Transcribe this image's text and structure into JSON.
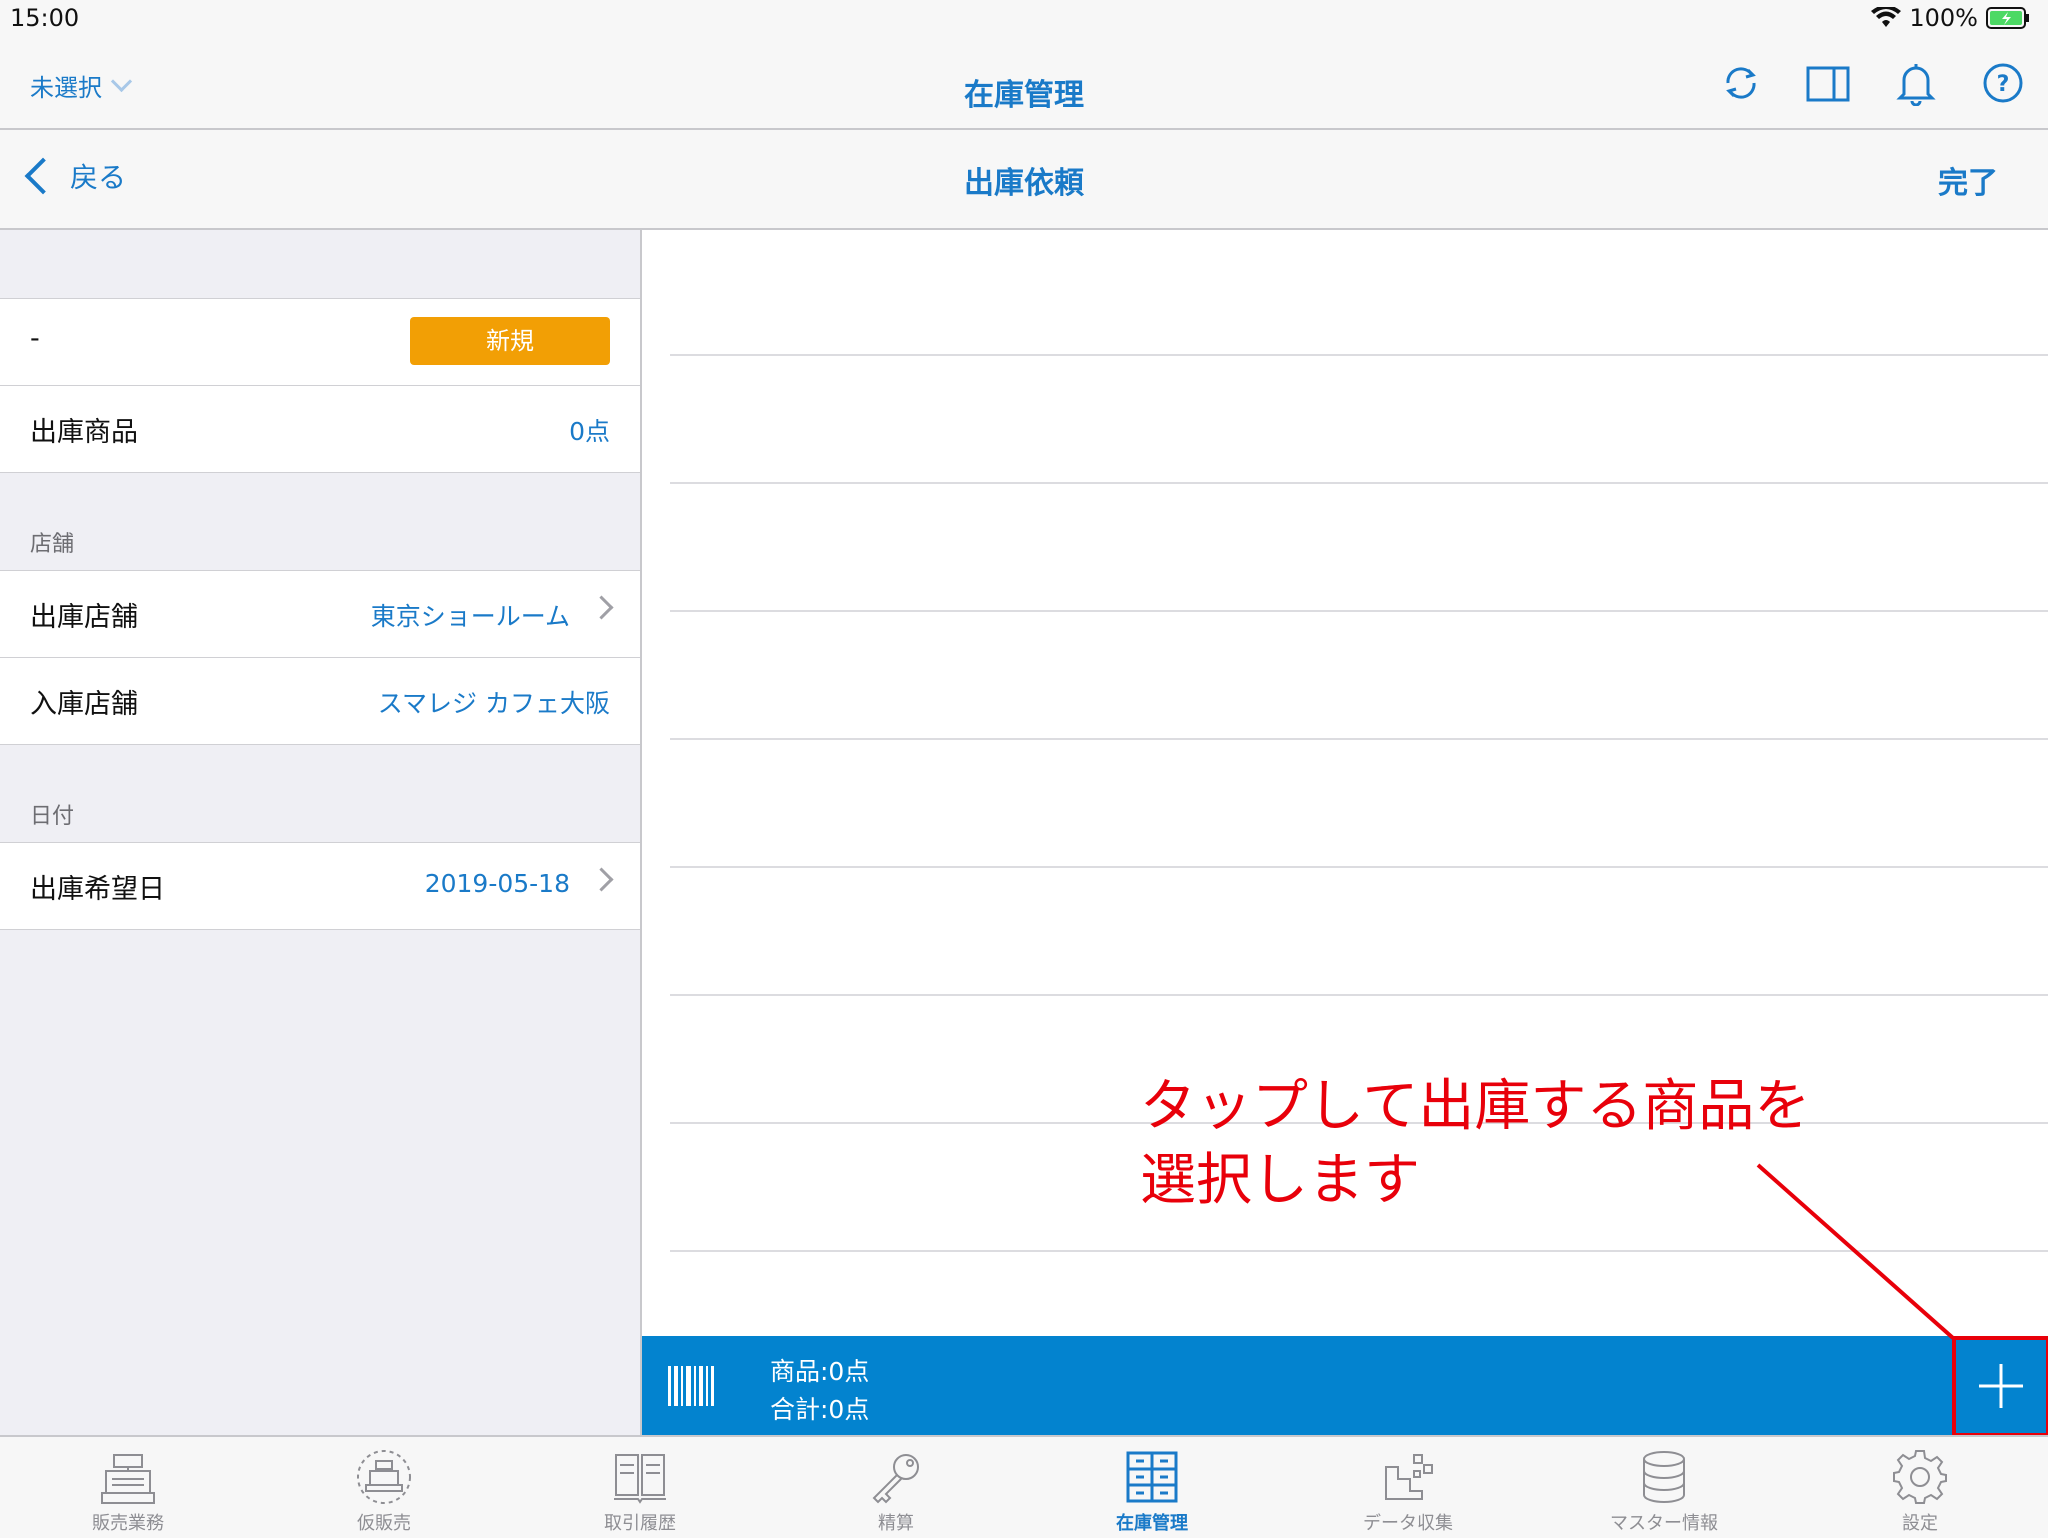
{
  "status": {
    "time": "15:00",
    "battery": "100%"
  },
  "topnav": {
    "selector": "未選択",
    "title": "在庫管理"
  },
  "subnav": {
    "back": "戻る",
    "title": "出庫依頼",
    "done": "完了"
  },
  "left": {
    "request_no": "-",
    "status_badge": "新規",
    "items_label": "出庫商品",
    "items_value": "0点",
    "section_store": "店舗",
    "from_store_label": "出庫店舗",
    "from_store_value": "東京ショールーム",
    "to_store_label": "入庫店舗",
    "to_store_value": "スマレジ カフェ大阪",
    "section_date": "日付",
    "date_label": "出庫希望日",
    "date_value": "2019-05-18"
  },
  "bottombar": {
    "products": "商品:0点",
    "total": "合計:0点"
  },
  "annotation": {
    "line1": "タップして出庫する商品を",
    "line2": "選択します"
  },
  "tabs": [
    {
      "label": "販売業務",
      "icon": "register-icon"
    },
    {
      "label": "仮販売",
      "icon": "temp-register-icon"
    },
    {
      "label": "取引履歴",
      "icon": "book-icon"
    },
    {
      "label": "精算",
      "icon": "key-icon"
    },
    {
      "label": "在庫管理",
      "icon": "inventory-icon"
    },
    {
      "label": "データ収集",
      "icon": "data-collection-icon"
    },
    {
      "label": "マスター情報",
      "icon": "database-icon"
    },
    {
      "label": "設定",
      "icon": "gear-icon"
    }
  ],
  "colors": {
    "accent": "#1a7ac8",
    "badge": "#f29f05",
    "bar": "#0383cf",
    "annotation": "#e8000a"
  }
}
